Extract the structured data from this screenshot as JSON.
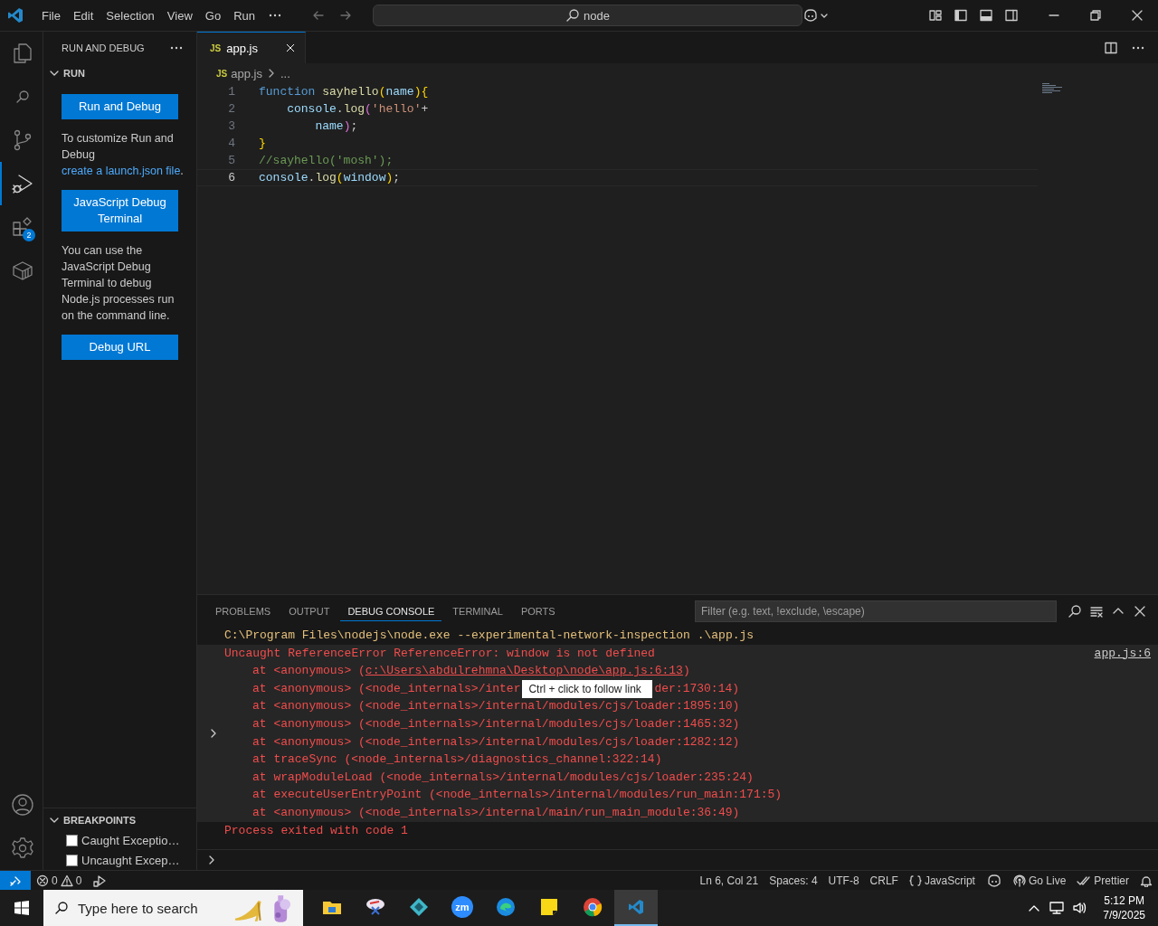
{
  "title_bar": {
    "menu": [
      "File",
      "Edit",
      "Selection",
      "View",
      "Go",
      "Run"
    ],
    "command_center": "node"
  },
  "activity_bar": {
    "items": [
      {
        "kind": "files",
        "selected": false
      },
      {
        "kind": "search",
        "selected": false
      },
      {
        "kind": "branch",
        "selected": false
      },
      {
        "kind": "run-debug",
        "selected": true
      },
      {
        "kind": "extensions",
        "selected": false,
        "badge": "2"
      },
      {
        "kind": "package",
        "selected": false
      }
    ],
    "bottom": [
      {
        "kind": "account"
      },
      {
        "kind": "gear"
      }
    ]
  },
  "sidebar": {
    "title": "RUN AND DEBUG",
    "run_section": {
      "title": "RUN",
      "expanded": true,
      "blocks": [
        {
          "kind": "button",
          "text": "Run and Debug"
        },
        {
          "kind": "text",
          "parts": [
            {
              "text": "To customize Run and Debug ",
              "kind": "text"
            },
            {
              "text": "create a launch.json file",
              "kind": "link"
            },
            {
              "text": ".",
              "kind": "text"
            }
          ]
        },
        {
          "kind": "button",
          "text": "JavaScript Debug Terminal"
        },
        {
          "kind": "text",
          "parts": [
            {
              "text": "You can use the JavaScript Debug Terminal to debug Node.js processes run on the command line.",
              "kind": "text"
            }
          ]
        },
        {
          "kind": "button",
          "text": "Debug URL"
        }
      ]
    },
    "breakpoints": {
      "title": "BREAKPOINTS",
      "expanded": true,
      "items": [
        {
          "label": "Caught Exceptio…",
          "checked": false
        },
        {
          "label": "Uncaught Excep…",
          "checked": false
        }
      ]
    }
  },
  "editor": {
    "tabs": [
      {
        "badge": "JS",
        "label": "app.js",
        "selected": true
      }
    ],
    "breadcrumb": {
      "badge": "JS",
      "file": "app.js",
      "rest": "..."
    },
    "lines": [
      {
        "number": "1",
        "current": false,
        "tokens": [
          {
            "text": "function",
            "kind": "keyword"
          },
          {
            "text": " sayhello",
            "kind": "function"
          },
          {
            "text": "(",
            "kind": "bracket1"
          },
          {
            "text": "name",
            "kind": "variable"
          },
          {
            "text": "){",
            "kind": "bracket1"
          }
        ]
      },
      {
        "number": "2",
        "current": false,
        "tokens": [
          {
            "text": "    console",
            "kind": "variable"
          },
          {
            "text": ".",
            "kind": "plain"
          },
          {
            "text": "log",
            "kind": "function"
          },
          {
            "text": "(",
            "kind": "bracket2"
          },
          {
            "text": "'hello'",
            "kind": "string"
          },
          {
            "text": "+",
            "kind": "plain"
          }
        ]
      },
      {
        "number": "3",
        "current": false,
        "tokens": [
          {
            "text": "        name",
            "kind": "variable"
          },
          {
            "text": ")",
            "kind": "bracket2"
          },
          {
            "text": ";",
            "kind": "plain"
          }
        ]
      },
      {
        "number": "4",
        "current": false,
        "tokens": [
          {
            "text": "}",
            "kind": "bracket1"
          }
        ]
      },
      {
        "number": "5",
        "current": false,
        "tokens": [
          {
            "text": "//sayhello('mosh');",
            "kind": "comment"
          }
        ]
      },
      {
        "number": "6",
        "current": true,
        "tokens": [
          {
            "text": "console",
            "kind": "variable"
          },
          {
            "text": ".",
            "kind": "plain"
          },
          {
            "text": "log",
            "kind": "function"
          },
          {
            "text": "(",
            "kind": "bracket1"
          },
          {
            "text": "window",
            "kind": "variable"
          },
          {
            "text": ")",
            "kind": "bracket1"
          },
          {
            "text": ";",
            "kind": "plain"
          }
        ]
      }
    ]
  },
  "panel": {
    "tabs": [
      {
        "label": "PROBLEMS",
        "selected": false
      },
      {
        "label": "OUTPUT",
        "selected": false
      },
      {
        "label": "DEBUG CONSOLE",
        "selected": true
      },
      {
        "label": "TERMINAL",
        "selected": false
      },
      {
        "label": "PORTS",
        "selected": false
      }
    ],
    "filter": {
      "placeholder": "Filter (e.g. text, !exclude, \\escape)"
    },
    "console": [
      {
        "kind": "command",
        "text": "C:\\Program Files\\nodejs\\node.exe --experimental-network-inspection .\\app.js"
      },
      {
        "kind": "group",
        "message": "Uncaught ReferenceError ReferenceError: window is not defined",
        "source": "app.js:6",
        "stack": [
          [
            {
              "kind": "text",
              "text": "at <anonymous> ("
            },
            {
              "kind": "link",
              "text": "c:\\Users\\abdulrehmna\\Desktop\\node\\app.js:6:13"
            },
            {
              "kind": "text",
              "text": ")"
            }
          ],
          [
            {
              "kind": "text",
              "text": "at <anonymous> (<node_internals>/inter"
            },
            {
              "kind": "tooltip",
              "text": "Ctrl + click to follow link"
            },
            {
              "kind": "text",
              "text": "der:1730:14)"
            }
          ],
          [
            {
              "kind": "text",
              "text": "at <anonymous> (<node_internals>/internal/modules/cjs/loader:1895:10)"
            }
          ],
          [
            {
              "kind": "text",
              "text": "at <anonymous> (<node_internals>/internal/modules/cjs/loader:1465:32)"
            }
          ],
          [
            {
              "kind": "text",
              "text": "at <anonymous> (<node_internals>/internal/modules/cjs/loader:1282:12)"
            }
          ],
          [
            {
              "kind": "text",
              "text": "at traceSync (<node_internals>/diagnostics_channel:322:14)"
            }
          ],
          [
            {
              "kind": "text",
              "text": "at wrapModuleLoad (<node_internals>/internal/modules/cjs/loader:235:24)"
            }
          ],
          [
            {
              "kind": "text",
              "text": "at executeUserEntryPoint (<node_internals>/internal/modules/run_main:171:5)"
            }
          ],
          [
            {
              "kind": "text",
              "text": "at <anonymous> (<node_internals>/internal/main/run_main_module:36:49)"
            }
          ]
        ]
      },
      {
        "kind": "exit",
        "text": "Process exited with code 1"
      }
    ]
  },
  "status_bar": {
    "left": [
      {
        "kind": "remote"
      },
      {
        "kind": "problems",
        "errors": "0",
        "warnings": "0"
      },
      {
        "kind": "debug"
      }
    ],
    "right": [
      {
        "kind": "text",
        "text": "Ln 6, Col 21"
      },
      {
        "kind": "text",
        "text": "Spaces: 4"
      },
      {
        "kind": "text",
        "text": "UTF-8"
      },
      {
        "kind": "text",
        "text": "CRLF"
      },
      {
        "kind": "braces",
        "text": "JavaScript"
      },
      {
        "kind": "copilot"
      },
      {
        "kind": "broadcast",
        "text": "Go Live"
      },
      {
        "kind": "checks",
        "text": "Prettier"
      },
      {
        "kind": "bell"
      }
    ]
  },
  "taskbar": {
    "search": {
      "placeholder": "Type here to search"
    },
    "apps": [
      {
        "kind": "folder",
        "selected": false
      },
      {
        "kind": "snip",
        "selected": false
      },
      {
        "kind": "diamond",
        "selected": false
      },
      {
        "kind": "zoom",
        "label": "zm",
        "selected": false
      },
      {
        "kind": "edge",
        "selected": false
      },
      {
        "kind": "sticky",
        "selected": false
      },
      {
        "kind": "chrome",
        "selected": false
      },
      {
        "kind": "vscode",
        "selected": true
      }
    ],
    "time": "5:12 PM",
    "date": "7/9/2025"
  }
}
